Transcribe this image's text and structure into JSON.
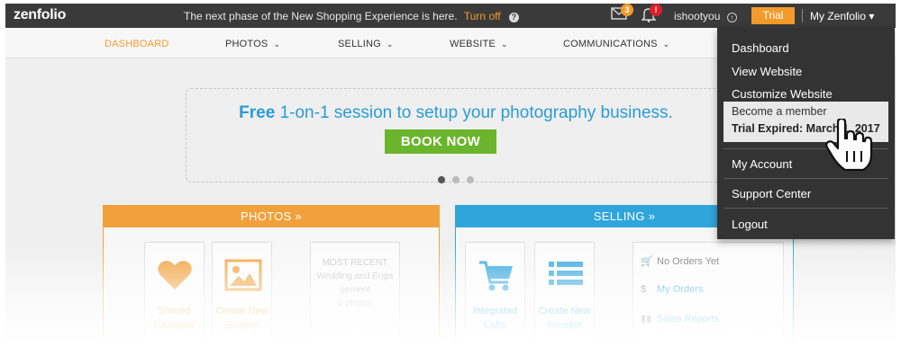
{
  "topbar": {
    "logo": "zenfolio",
    "announcement": "The next phase of the New Shopping Experience is here.",
    "turn_off": "Turn off",
    "help_glyph": "?",
    "mail_count": "3",
    "alert_count": "!",
    "username": "ishootyou",
    "trial_label": "Trial",
    "my_zenfolio": "My Zenfolio ▾"
  },
  "nav": {
    "items": [
      {
        "label": "DASHBOARD",
        "caret": ""
      },
      {
        "label": "PHOTOS",
        "caret": "⌄"
      },
      {
        "label": "SELLING",
        "caret": "⌄"
      },
      {
        "label": "WEBSITE",
        "caret": "⌄"
      },
      {
        "label": "COMMUNICATIONS",
        "caret": "⌄"
      }
    ]
  },
  "banner": {
    "free": "Free",
    "rest": " 1-on-1 session to setup your photography business.",
    "button": "BOOK NOW"
  },
  "photos_panel": {
    "title": "PHOTOS »",
    "tiles": [
      {
        "line1": "Shared",
        "line2": "Favorites"
      },
      {
        "line1": "Create New",
        "line2": "Gallery"
      }
    ],
    "recent": {
      "l1": "MOST RECENT",
      "l2": "Wedding and Enga",
      "l3": "gement",
      "l4": "0 photos"
    }
  },
  "selling_panel": {
    "title": "SELLING »",
    "tiles": [
      {
        "line1": "Integrated",
        "line2": "Labs"
      },
      {
        "line1": "Create New",
        "line2": "Pricelist"
      }
    ],
    "orders": [
      {
        "icon": "🛒",
        "label": "No Orders Yet"
      },
      {
        "icon": "$",
        "label": "My Orders"
      },
      {
        "icon": "▮▮",
        "label": "Sales Reports"
      }
    ]
  },
  "dropdown": {
    "items": [
      "Dashboard",
      "View Website",
      "Customize Website"
    ],
    "member_line1": "Become a member",
    "member_line2": "Trial Expired: March 1, 2017",
    "items2": [
      "My Account",
      "Support Center",
      "Logout"
    ]
  },
  "colors": {
    "orange": "#f29b2a",
    "blue": "#2fa5dc",
    "green": "#6ab52b",
    "dark": "#3a3a3a"
  }
}
